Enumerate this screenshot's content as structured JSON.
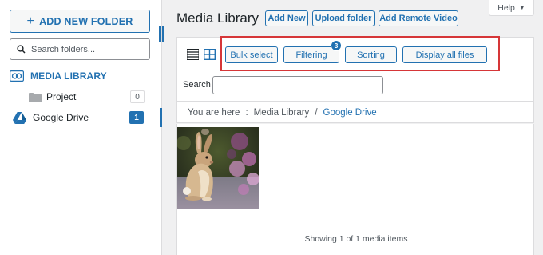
{
  "sidebar": {
    "add_folder_label": "ADD NEW FOLDER",
    "search_placeholder": "Search folders...",
    "library_label": "MEDIA LIBRARY",
    "folders": [
      {
        "label": "Project",
        "count": "0"
      }
    ],
    "drive": {
      "label": "Google Drive",
      "count": "1"
    }
  },
  "header": {
    "title": "Media Library",
    "buttons": [
      "Add New",
      "Upload folder",
      "Add Remote Video"
    ],
    "help_label": "Help"
  },
  "toolbar": {
    "bulk_select": "Bulk select",
    "filtering": "Filtering",
    "filtering_badge": "3",
    "sorting": "Sorting",
    "display_all": "Display all files",
    "search_label": "Search"
  },
  "breadcrumb": {
    "prefix": "You are here",
    "separator": ":",
    "root": "Media Library",
    "divider": "/",
    "current": "Google Drive"
  },
  "media": {
    "items": [
      {
        "alt": "rabbit photo"
      }
    ],
    "status": "Showing 1 of 1 media items"
  },
  "colors": {
    "accent": "#2271b1",
    "highlight": "#d63638"
  }
}
